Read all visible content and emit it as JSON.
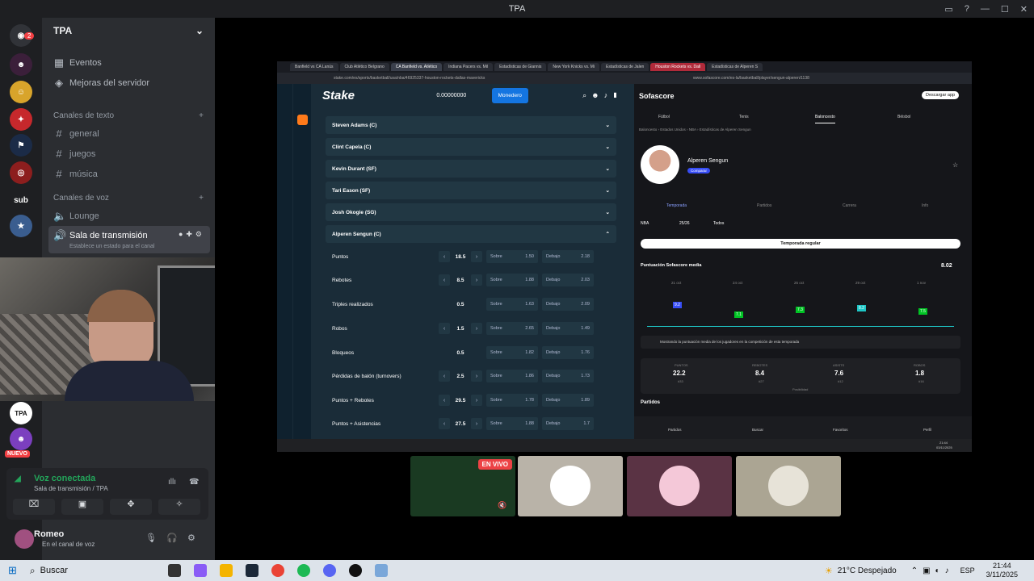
{
  "window": {
    "title": "TPA",
    "server_name": "TPA"
  },
  "sidebar": {
    "events": "Eventos",
    "boosts": "Mejoras del servidor",
    "text_category": "Canales de texto",
    "text_channels": [
      "general",
      "juegos",
      "música"
    ],
    "voice_category": "Canales de voz",
    "voice_channels": [
      "Lounge",
      "Sala de transmisión"
    ],
    "status_hint": "Establece un estado para el canal"
  },
  "servers": {
    "badge": "2",
    "new_badge": "NUEVO",
    "sub_label": "sub",
    "tpa_label": "TPA"
  },
  "voice": {
    "connected": "Voz conectada",
    "channel": "Sala de transmisión / TPA"
  },
  "user": {
    "name": "Romeo",
    "status": "En el canal de voz"
  },
  "live_badge": "EN VIVO",
  "stream": {
    "tabs": [
      "Banfield vs CA Lanús",
      "Club Atlético Belgrano",
      "CA Banfield vs. Atlético",
      "Indiana Pacers vs. Mil",
      "Estadísticas de Giannis",
      "New York Knicks vs. Mi",
      "Estadísticas de Jalen",
      "Houston Rockets vs. Dall",
      "Estadísticas de Alperen S"
    ],
    "stake_url": "stake.com/es/sports/basketball/usa/nba/46925337-houston-rockets-dallas-mavericks",
    "sofa_url": "www.sofascore.com/es-la/basketball/player/sengun-alperen/1138",
    "stake": {
      "logo": "Stake",
      "balance": "0.00000000",
      "wallet": "Monedero",
      "players": [
        "Steven Adams (C)",
        "Clint Capela (C)",
        "Kevin Durant (SF)",
        "Tari Eason (SF)",
        "Josh Okogie (SG)",
        "Alperen Sengun (C)"
      ],
      "markets": [
        {
          "name": "Puntos",
          "line": "18.5",
          "over": "Sobre",
          "over_odds": "1.50",
          "under": "Debajo",
          "under_odds": "2.18"
        },
        {
          "name": "Rebotes",
          "line": "8.5",
          "over": "Sobre",
          "over_odds": "1.88",
          "under": "Debajo",
          "under_odds": "2.03"
        },
        {
          "name": "Triples realizados",
          "line": "0.5",
          "over": "Sobre",
          "over_odds": "1.63",
          "under": "Debajo",
          "under_odds": "2.09"
        },
        {
          "name": "Robos",
          "line": "1.5",
          "over": "Sobre",
          "over_odds": "2.65",
          "under": "Debajo",
          "under_odds": "1.49"
        },
        {
          "name": "Bloqueos",
          "line": "0.5",
          "over": "Sobre",
          "over_odds": "1.82",
          "under": "Debajo",
          "under_odds": "1.76"
        },
        {
          "name": "Pérdidas de balón (turnovers)",
          "line": "2.5",
          "over": "Sobre",
          "over_odds": "1.86",
          "under": "Debajo",
          "under_odds": "1.73"
        },
        {
          "name": "Puntos + Rebotes",
          "line": "29.5",
          "over": "Sobre",
          "over_odds": "1.78",
          "under": "Debajo",
          "under_odds": "1.89"
        },
        {
          "name": "Puntos + Asistencias",
          "line": "27.5",
          "over": "Sobre",
          "over_odds": "1.88",
          "under": "Debajo",
          "under_odds": "1.7"
        }
      ]
    },
    "sofa": {
      "logo": "Sofascore",
      "download": "Descargar app",
      "sports": [
        "Fútbol",
        "Tenis",
        "Baloncesto",
        "Béisbol"
      ],
      "breadcrumb": "Baloncesto › Estados Unidos › NBA › Estadísticas de Alperen Sengun",
      "player": "Alperen Sengun",
      "compare": "Comparar",
      "tabs": [
        "Temporada",
        "Partidos",
        "Carrera",
        "Info"
      ],
      "filters": [
        "NBA",
        "25/26",
        "Todos"
      ],
      "season_btn": "Temporada regular",
      "rating_title": "Puntuación Sofascore media",
      "rating": "8.02",
      "dates": [
        "21 oct",
        "24 oct",
        "25 oct",
        "29 oct",
        "1 nov"
      ],
      "ratings": [
        "9.2",
        "7.1",
        "7.3",
        "8.2",
        "7.5"
      ],
      "notice": "Mostrando la puntuación media de los jugadores en la competición de esta temporada",
      "stats": [
        {
          "label": "PUNTOS",
          "value": "22.2",
          "rank": "#33"
        },
        {
          "label": "REBOTES",
          "value": "8.4",
          "rank": "#27"
        },
        {
          "label": "ASISTS",
          "value": "7.6",
          "rank": "#12"
        },
        {
          "label": "ROBOS",
          "value": "1.8",
          "rank": "#16"
        }
      ],
      "stats_note": "Posibilidad",
      "matches": "Partidos",
      "bottom_nav": [
        "Partidos",
        "Buscar",
        "Favoritos",
        "Perfil"
      ]
    },
    "taskbar_time": "21:44",
    "taskbar_date": "03/11/2025"
  },
  "taskbar": {
    "search": "Buscar",
    "weather": "21°C  Despejado",
    "lang": "ESP",
    "time": "21:44",
    "date": "3/11/2025"
  }
}
